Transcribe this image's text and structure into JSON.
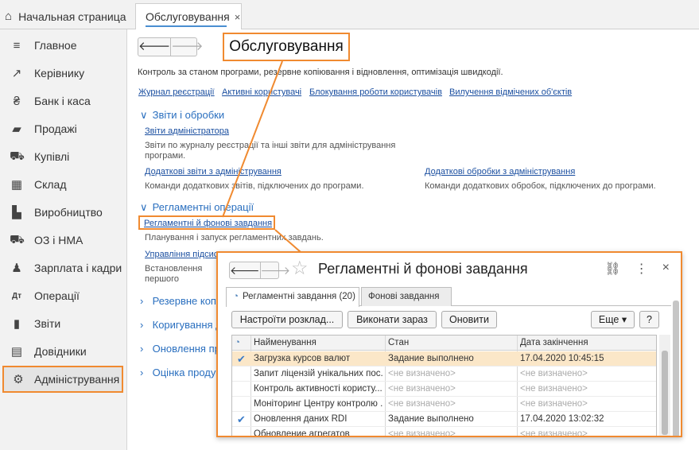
{
  "tabs": {
    "home": "Начальная страница",
    "active": "Обслуговування",
    "close": "×"
  },
  "sidebar": {
    "items": [
      {
        "label": "Главное",
        "icon": "≡"
      },
      {
        "label": "Керівнику",
        "icon": "↗"
      },
      {
        "label": "Банк і каса",
        "icon": "₴"
      },
      {
        "label": "Продажі",
        "icon": "▰"
      },
      {
        "label": "Купівлі",
        "icon": "⛟"
      },
      {
        "label": "Склад",
        "icon": "▦"
      },
      {
        "label": "Виробництво",
        "icon": "▙"
      },
      {
        "label": "ОЗ і НМА",
        "icon": "⛟"
      },
      {
        "label": "Зарплата і кадри",
        "icon": "♟"
      },
      {
        "label": "Операції",
        "icon": "Дт"
      },
      {
        "label": "Звіти",
        "icon": "▮"
      },
      {
        "label": "Довідники",
        "icon": "▤"
      },
      {
        "label": "Адміністрування",
        "icon": "⚙"
      }
    ]
  },
  "main": {
    "nav": {
      "back": "🡐",
      "forward": "🡒"
    },
    "callout": "Обслуговування",
    "description": "Контроль за станом програми, резервне копіювання і відновлення, оптимізація швидкодії.",
    "top_links": [
      "Журнал реєстрації",
      "Активні користувачі",
      "Блокування роботи користувачів",
      "Вилучення відмічених об'єктів"
    ],
    "sections": [
      {
        "title": "Звіти і обробки",
        "chev": "∨"
      },
      {
        "title": "Регламентні операції",
        "chev": "∨"
      },
      {
        "title": "Резервне копіювання і відновлення",
        "chev": "›"
      },
      {
        "title": "Коригування даних",
        "chev": "›"
      },
      {
        "title": "Оновлення програми",
        "chev": "›"
      },
      {
        "title": "Оцінка продуктивності",
        "chev": "›"
      }
    ],
    "reports": {
      "admin_reports": "Звіти адміністратора",
      "admin_reports_desc": "Звіти по журналу реєстрації та інші звіти для адміністрування програми.",
      "extra_reports": "Додаткові звіти з адміністрування",
      "extra_reports_desc": "Команди додаткових звітів, підключених до програми.",
      "extra_processing": "Додаткові обробки з адміністрування",
      "extra_processing_desc": "Команди додаткових обробок, підключених до програми."
    },
    "ops": {
      "scheduled": "Регламентні й фонові завдання",
      "scheduled_desc": "Планування і запуск регламентних завдань.",
      "manage": "Управління підсистемами",
      "manage_desc": "Встановлення першого заповнення та обробки даних. Перебудова, запуск"
    }
  },
  "window": {
    "title": "Регламентні й фонові завдання",
    "nav": {
      "back": "🡐",
      "forward": "🡒"
    },
    "star": "☆",
    "icons": {
      "link": "⛓",
      "more": "⋮",
      "close": "×"
    },
    "tabs": [
      "Регламентні завдання (20)",
      "Фонові завдання"
    ],
    "tab_icon": "◔",
    "buttons": {
      "configure": "Настроїти розклад...",
      "run": "Виконати зараз",
      "refresh": "Оновити",
      "more": "Еще ▾",
      "help": "?"
    },
    "columns": [
      "Найменування",
      "Стан",
      "Дата закінчення"
    ],
    "rows": [
      {
        "check": "✔",
        "name": "Загрузка курсов валют",
        "state": "Задание выполнено",
        "date": "17.04.2020 10:45:15"
      },
      {
        "check": "",
        "name": "Запит ліцензій унікальних пос...",
        "state": "<не визначено>",
        "date": "<не визначено>"
      },
      {
        "check": "",
        "name": "Контроль активності користу...",
        "state": "<не визначено>",
        "date": "<не визначено>"
      },
      {
        "check": "",
        "name": "Моніторинг Центру контролю ...",
        "state": "<не визначено>",
        "date": "<не визначено>"
      },
      {
        "check": "✔",
        "name": "Оновлення даних RDI",
        "state": "Задание выполнено",
        "date": "17.04.2020 13:02:32"
      },
      {
        "check": "",
        "name": "Обновление агрегатов",
        "state": "<не визначено>",
        "date": "<не визначено>"
      }
    ]
  },
  "colors": {
    "accent": "#f08a30",
    "link": "#1b4fa0",
    "section": "#2a6fbf"
  }
}
